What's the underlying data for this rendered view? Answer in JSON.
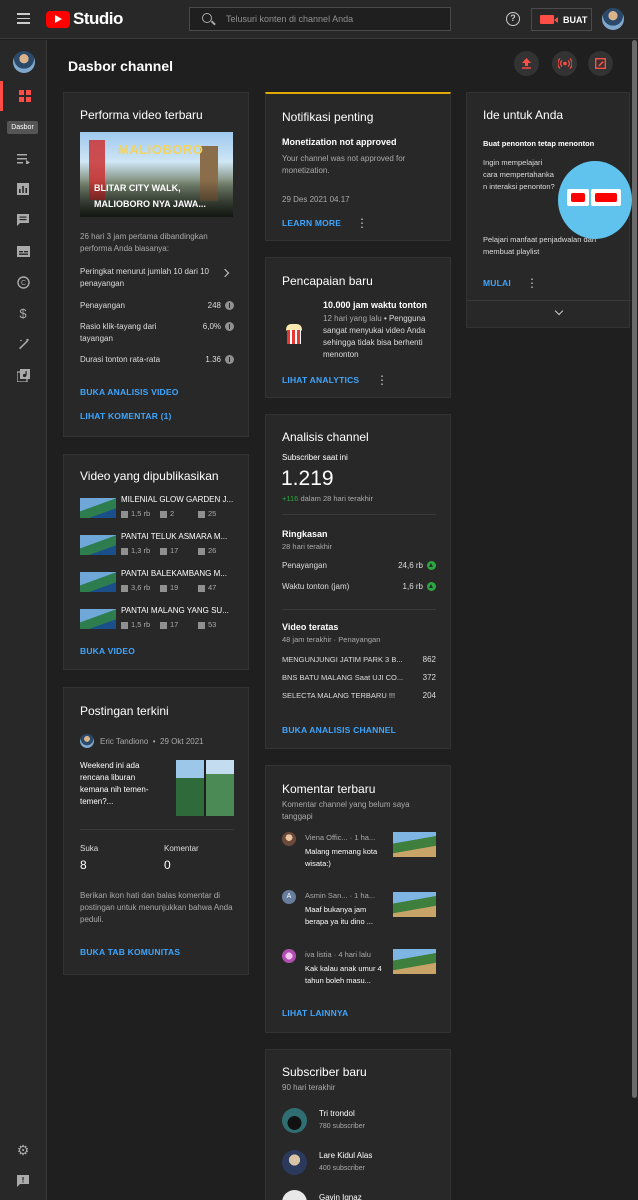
{
  "header": {
    "logo_text": "Studio",
    "search_placeholder": "Telusuri konten di channel Anda",
    "create_label": "BUAT",
    "help_label": "?"
  },
  "sidebar": {
    "tooltip": "Dasbor",
    "items": [
      "dashboard",
      "content",
      "analytics",
      "comments",
      "subtitles",
      "copyright",
      "monetization",
      "customization",
      "audio-library"
    ],
    "bottom": [
      "settings",
      "feedback"
    ]
  },
  "page": {
    "title": "Dasbor channel"
  },
  "performance": {
    "title": "Performa video terbaru",
    "video_title_line1": "BLITAR CITY WALK,",
    "video_title_line2": "MALIOBORO NYA JAWA...",
    "thumb_text": "MALIOBORO",
    "compare_text": "26 hari 3 jam pertama dibandingkan performa Anda biasanya:",
    "rank_text": "Peringkat menurut jumlah 10 dari 10 penayangan",
    "metrics": [
      {
        "label": "Penayangan",
        "value": "248"
      },
      {
        "label": "Rasio klik-tayang dari tayangan",
        "value": "6,0%"
      },
      {
        "label": "Durasi tonton rata-rata",
        "value": "1.36"
      }
    ],
    "link1": "BUKA ANALISIS VIDEO",
    "link2": "LIHAT KOMENTAR (1)"
  },
  "published": {
    "title": "Video yang dipublikasikan",
    "videos": [
      {
        "title": "MILENIAL GLOW GARDEN J...",
        "views": "1,5 rb",
        "comments": "2",
        "likes": "25"
      },
      {
        "title": "PANTAI TELUK ASMARA M...",
        "views": "1,3 rb",
        "comments": "17",
        "likes": "26"
      },
      {
        "title": "PANTAI BALEKAMBANG M...",
        "views": "3,6 rb",
        "comments": "19",
        "likes": "47"
      },
      {
        "title": "PANTAI MALANG YANG SU...",
        "views": "1,5 rb",
        "comments": "17",
        "likes": "53"
      }
    ],
    "link": "BUKA VIDEO"
  },
  "posts": {
    "title": "Postingan terkini",
    "author": "Eric Tandiono",
    "date": "29 Okt 2021",
    "text": "Weekend ini ada rencana liburan kemana nih temen-temen?...",
    "likes_label": "Suka",
    "likes_value": "8",
    "comments_label": "Komentar",
    "comments_value": "0",
    "note": "Berikan ikon hati dan balas komentar di postingan untuk menunjukkan bahwa Anda peduli.",
    "link": "BUKA TAB KOMUNITAS"
  },
  "notification": {
    "title": "Notifikasi penting",
    "headline": "Monetization not approved",
    "body": "Your channel was not approved for monetization.",
    "date": "29 Des 2021 04.17",
    "link": "LEARN MORE"
  },
  "achievement": {
    "title": "Pencapaian baru",
    "headline": "10.000 jam waktu tonton",
    "time": "12 hari yang lalu",
    "body": "Pengguna sangat menyukai video Anda sehingga tidak bisa berhenti menonton",
    "link": "LIHAT ANALYTICS"
  },
  "analytics": {
    "title": "Analisis channel",
    "subs_label": "Subscriber saat ini",
    "subs_value": "1.219",
    "subs_delta": "+116",
    "subs_delta_suffix": "dalam 28 hari terakhir",
    "summary_title": "Ringkasan",
    "summary_period": "28 hari terakhir",
    "summary": [
      {
        "label": "Penayangan",
        "value": "24,6 rb"
      },
      {
        "label": "Waktu tonton (jam)",
        "value": "1,6 rb"
      }
    ],
    "top_title": "Video teratas",
    "top_period": "48 jam terakhir · Penayangan",
    "top_videos": [
      {
        "title": "MENGUNJUNGI JATIM PARK 3 B...",
        "value": "862"
      },
      {
        "title": "BNS BATU MALANG Saat UJI CO...",
        "value": "372"
      },
      {
        "title": "SELECTA MALANG TERBARU !!!",
        "value": "204"
      }
    ],
    "link": "BUKA ANALISIS CHANNEL"
  },
  "comments": {
    "title": "Komentar terbaru",
    "subtitle": "Komentar channel yang belum saya tanggapi",
    "items": [
      {
        "author": "Viena Offic... · 1 ha...",
        "text": "Malang memang kota wisata:)",
        "avatar_letter": ""
      },
      {
        "author": "Asmin San... · 1 ha...",
        "text": "Maaf bukanya jam berapa ya itu dino ...",
        "avatar_letter": "A"
      },
      {
        "author": "iva listia · 4 hari lalu",
        "text": "Kak kalau anak umur 4 tahun boleh masu...",
        "avatar_letter": ""
      }
    ],
    "link": "LIHAT LAINNYA"
  },
  "subscribers": {
    "title": "Subscriber baru",
    "period": "90 hari terakhir",
    "items": [
      {
        "name": "Tri trondol",
        "count": "780 subscriber"
      },
      {
        "name": "Lare Kidul Alas",
        "count": "400 subscriber"
      },
      {
        "name": "Gavin Ignaz",
        "count": ""
      }
    ]
  },
  "ideas": {
    "title": "Ide untuk Anda",
    "subtitle": "Buat penonton tetap menonton",
    "body1": "Ingin mempelajari cara mempertahanka n interaksi penonton?",
    "body2": "Pelajari manfaat penjadwalan dan membuat playlist",
    "link": "MULAI"
  },
  "colors": {
    "accent": "#ff4e45",
    "link": "#3ea6ff",
    "positive": "#2ba640",
    "notification_bar": "#e0a800"
  }
}
